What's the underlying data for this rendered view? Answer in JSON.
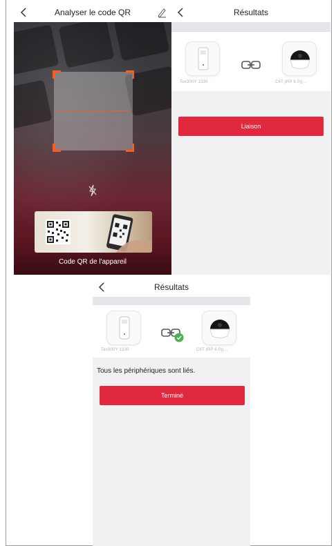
{
  "scanner": {
    "title": "Analyser le code QR",
    "qr_caption": "Code QR de l'appareil"
  },
  "results_top": {
    "title": "Résultats",
    "device_left": "Tex300Y 1330",
    "device_right": "C6T (RP 6.0)(...",
    "button_label": "Liaison"
  },
  "results_bottom": {
    "title": "Résultats",
    "device_left": "Tex300Y 1330",
    "device_right": "C6T (RP 6.0)(...",
    "status_text": "Tous les périphériques sont liés.",
    "button_label": "Terminé"
  },
  "colors": {
    "accent": "#e0283e",
    "scan_frame": "#ff5a1f",
    "success": "#4caf50"
  },
  "icons": [
    "back-arrow-icon",
    "edit-pencil-icon",
    "flash-off-icon",
    "link-icon",
    "check-badge-icon"
  ]
}
